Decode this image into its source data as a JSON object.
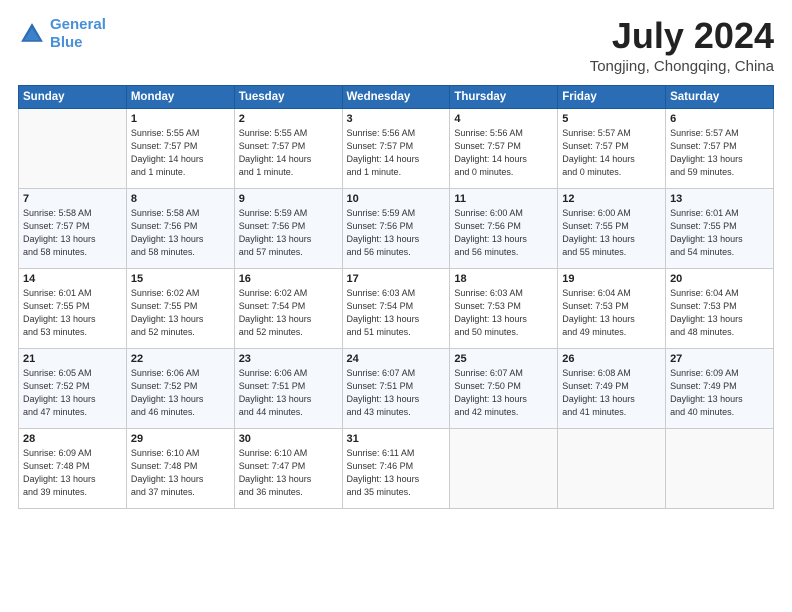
{
  "header": {
    "logo_line1": "General",
    "logo_line2": "Blue",
    "month": "July 2024",
    "location": "Tongjing, Chongqing, China"
  },
  "days_of_week": [
    "Sunday",
    "Monday",
    "Tuesday",
    "Wednesday",
    "Thursday",
    "Friday",
    "Saturday"
  ],
  "weeks": [
    [
      {
        "day": "",
        "info": ""
      },
      {
        "day": "1",
        "info": "Sunrise: 5:55 AM\nSunset: 7:57 PM\nDaylight: 14 hours\nand 1 minute."
      },
      {
        "day": "2",
        "info": "Sunrise: 5:55 AM\nSunset: 7:57 PM\nDaylight: 14 hours\nand 1 minute."
      },
      {
        "day": "3",
        "info": "Sunrise: 5:56 AM\nSunset: 7:57 PM\nDaylight: 14 hours\nand 1 minute."
      },
      {
        "day": "4",
        "info": "Sunrise: 5:56 AM\nSunset: 7:57 PM\nDaylight: 14 hours\nand 0 minutes."
      },
      {
        "day": "5",
        "info": "Sunrise: 5:57 AM\nSunset: 7:57 PM\nDaylight: 14 hours\nand 0 minutes."
      },
      {
        "day": "6",
        "info": "Sunrise: 5:57 AM\nSunset: 7:57 PM\nDaylight: 13 hours\nand 59 minutes."
      }
    ],
    [
      {
        "day": "7",
        "info": "Sunrise: 5:58 AM\nSunset: 7:57 PM\nDaylight: 13 hours\nand 58 minutes."
      },
      {
        "day": "8",
        "info": "Sunrise: 5:58 AM\nSunset: 7:56 PM\nDaylight: 13 hours\nand 58 minutes."
      },
      {
        "day": "9",
        "info": "Sunrise: 5:59 AM\nSunset: 7:56 PM\nDaylight: 13 hours\nand 57 minutes."
      },
      {
        "day": "10",
        "info": "Sunrise: 5:59 AM\nSunset: 7:56 PM\nDaylight: 13 hours\nand 56 minutes."
      },
      {
        "day": "11",
        "info": "Sunrise: 6:00 AM\nSunset: 7:56 PM\nDaylight: 13 hours\nand 56 minutes."
      },
      {
        "day": "12",
        "info": "Sunrise: 6:00 AM\nSunset: 7:55 PM\nDaylight: 13 hours\nand 55 minutes."
      },
      {
        "day": "13",
        "info": "Sunrise: 6:01 AM\nSunset: 7:55 PM\nDaylight: 13 hours\nand 54 minutes."
      }
    ],
    [
      {
        "day": "14",
        "info": "Sunrise: 6:01 AM\nSunset: 7:55 PM\nDaylight: 13 hours\nand 53 minutes."
      },
      {
        "day": "15",
        "info": "Sunrise: 6:02 AM\nSunset: 7:55 PM\nDaylight: 13 hours\nand 52 minutes."
      },
      {
        "day": "16",
        "info": "Sunrise: 6:02 AM\nSunset: 7:54 PM\nDaylight: 13 hours\nand 52 minutes."
      },
      {
        "day": "17",
        "info": "Sunrise: 6:03 AM\nSunset: 7:54 PM\nDaylight: 13 hours\nand 51 minutes."
      },
      {
        "day": "18",
        "info": "Sunrise: 6:03 AM\nSunset: 7:53 PM\nDaylight: 13 hours\nand 50 minutes."
      },
      {
        "day": "19",
        "info": "Sunrise: 6:04 AM\nSunset: 7:53 PM\nDaylight: 13 hours\nand 49 minutes."
      },
      {
        "day": "20",
        "info": "Sunrise: 6:04 AM\nSunset: 7:53 PM\nDaylight: 13 hours\nand 48 minutes."
      }
    ],
    [
      {
        "day": "21",
        "info": "Sunrise: 6:05 AM\nSunset: 7:52 PM\nDaylight: 13 hours\nand 47 minutes."
      },
      {
        "day": "22",
        "info": "Sunrise: 6:06 AM\nSunset: 7:52 PM\nDaylight: 13 hours\nand 46 minutes."
      },
      {
        "day": "23",
        "info": "Sunrise: 6:06 AM\nSunset: 7:51 PM\nDaylight: 13 hours\nand 44 minutes."
      },
      {
        "day": "24",
        "info": "Sunrise: 6:07 AM\nSunset: 7:51 PM\nDaylight: 13 hours\nand 43 minutes."
      },
      {
        "day": "25",
        "info": "Sunrise: 6:07 AM\nSunset: 7:50 PM\nDaylight: 13 hours\nand 42 minutes."
      },
      {
        "day": "26",
        "info": "Sunrise: 6:08 AM\nSunset: 7:49 PM\nDaylight: 13 hours\nand 41 minutes."
      },
      {
        "day": "27",
        "info": "Sunrise: 6:09 AM\nSunset: 7:49 PM\nDaylight: 13 hours\nand 40 minutes."
      }
    ],
    [
      {
        "day": "28",
        "info": "Sunrise: 6:09 AM\nSunset: 7:48 PM\nDaylight: 13 hours\nand 39 minutes."
      },
      {
        "day": "29",
        "info": "Sunrise: 6:10 AM\nSunset: 7:48 PM\nDaylight: 13 hours\nand 37 minutes."
      },
      {
        "day": "30",
        "info": "Sunrise: 6:10 AM\nSunset: 7:47 PM\nDaylight: 13 hours\nand 36 minutes."
      },
      {
        "day": "31",
        "info": "Sunrise: 6:11 AM\nSunset: 7:46 PM\nDaylight: 13 hours\nand 35 minutes."
      },
      {
        "day": "",
        "info": ""
      },
      {
        "day": "",
        "info": ""
      },
      {
        "day": "",
        "info": ""
      }
    ]
  ]
}
